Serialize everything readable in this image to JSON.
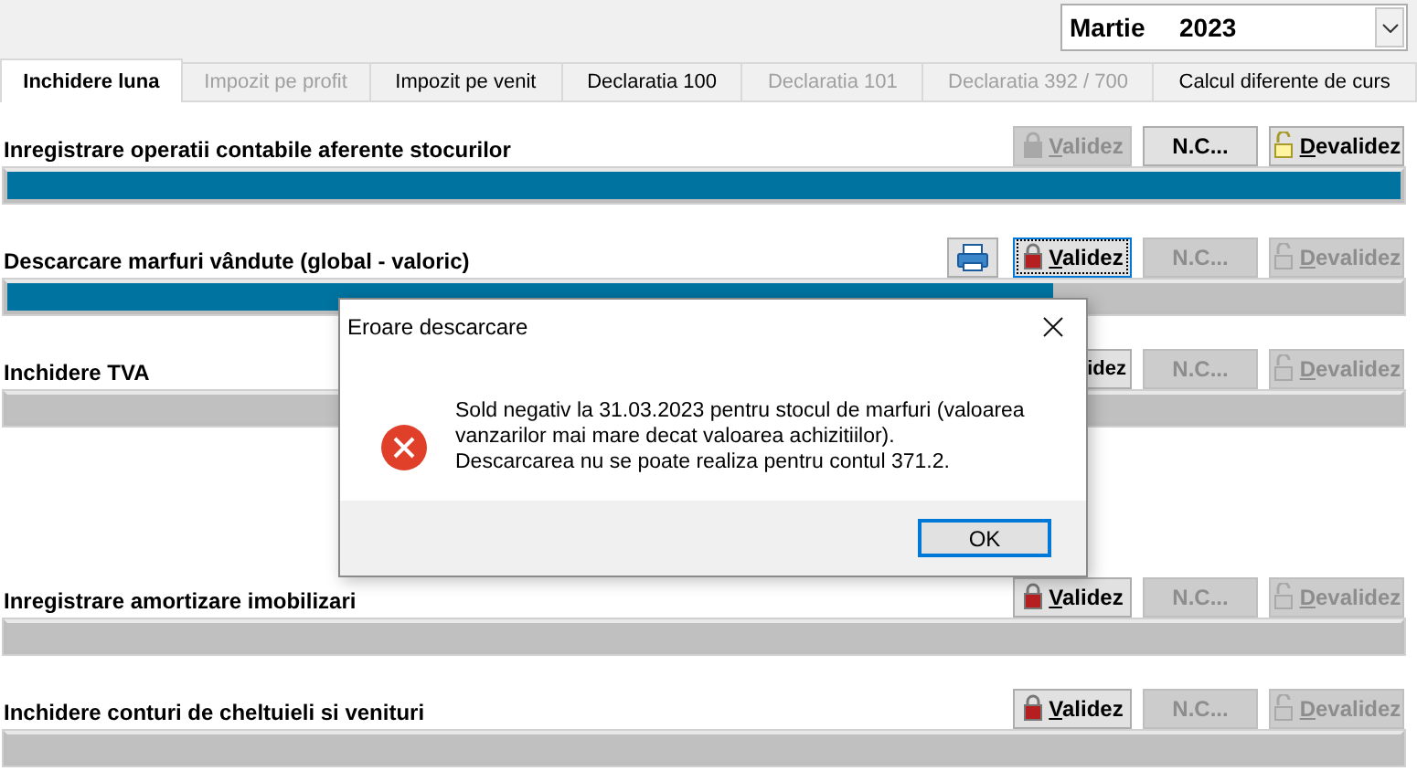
{
  "period": {
    "month": "Martie",
    "year": "2023"
  },
  "tabs": [
    {
      "label": "Inchidere luna",
      "selected": true,
      "disabled": false
    },
    {
      "label": "Impozit pe profit",
      "selected": false,
      "disabled": true
    },
    {
      "label": "Impozit pe venit",
      "selected": false,
      "disabled": false
    },
    {
      "label": "Declaratia 100",
      "selected": false,
      "disabled": false
    },
    {
      "label": "Declaratia 101",
      "selected": false,
      "disabled": true
    },
    {
      "label": "Declaratia 392 / 700",
      "selected": false,
      "disabled": true
    },
    {
      "label": "Calcul diferente de curs",
      "selected": false,
      "disabled": false
    }
  ],
  "sections": [
    {
      "title": "Inregistrare operatii contabile aferente stocurilor",
      "level": 1,
      "spaced": false,
      "print": false,
      "buttons": [
        {
          "kind": "validate",
          "label": "Validez",
          "disabled": true,
          "focused": false,
          "mnemonic": true,
          "locked": true
        },
        {
          "kind": "nc",
          "label": "N.C...",
          "disabled": false,
          "focused": false,
          "mnemonic": false
        },
        {
          "kind": "invalidate",
          "label": "Devalidez",
          "disabled": false,
          "focused": false,
          "mnemonic": true,
          "locked": false
        }
      ]
    },
    {
      "title": "Descarcare marfuri vândute (global - valoric)",
      "level": 0.75,
      "spaced": false,
      "print": true,
      "buttons": [
        {
          "kind": "validate",
          "label": "Validez",
          "disabled": false,
          "focused": true,
          "mnemonic": true,
          "locked": true
        },
        {
          "kind": "nc",
          "label": "N.C...",
          "disabled": true,
          "focused": false,
          "mnemonic": false
        },
        {
          "kind": "invalidate",
          "label": "Devalidez",
          "disabled": true,
          "focused": false,
          "mnemonic": true,
          "locked": false
        }
      ]
    },
    {
      "title": "Inchidere TVA",
      "level": 0,
      "spaced": false,
      "print": false,
      "buttons": [
        {
          "kind": "validate",
          "label": "idez",
          "disabled": false,
          "focused": false,
          "mnemonic": false,
          "clipped": true
        },
        {
          "kind": "nc",
          "label": "N.C...",
          "disabled": true,
          "focused": false,
          "mnemonic": false
        },
        {
          "kind": "invalidate",
          "label": "Devalidez",
          "disabled": true,
          "focused": false,
          "mnemonic": true,
          "locked": false
        }
      ]
    },
    {
      "title": "Inregistrare amortizare imobilizari",
      "level": 0,
      "spaced": true,
      "print": false,
      "buttons": [
        {
          "kind": "validate",
          "label": "Validez",
          "disabled": false,
          "focused": false,
          "mnemonic": true,
          "locked": true
        },
        {
          "kind": "nc",
          "label": "N.C...",
          "disabled": true,
          "focused": false,
          "mnemonic": false
        },
        {
          "kind": "invalidate",
          "label": "Devalidez",
          "disabled": true,
          "focused": false,
          "mnemonic": true,
          "locked": false
        }
      ]
    },
    {
      "title": "Inchidere conturi de cheltuieli si venituri",
      "level": 0,
      "spaced": false,
      "print": false,
      "buttons": [
        {
          "kind": "validate",
          "label": "Validez",
          "disabled": false,
          "focused": false,
          "mnemonic": true,
          "locked": true
        },
        {
          "kind": "nc",
          "label": "N.C...",
          "disabled": true,
          "focused": false,
          "mnemonic": false
        },
        {
          "kind": "invalidate",
          "label": "Devalidez",
          "disabled": true,
          "focused": false,
          "mnemonic": true,
          "locked": false
        }
      ]
    }
  ],
  "dialog": {
    "title": "Eroare descarcare",
    "message": "Sold negativ la 31.03.2023 pentru stocul de marfuri (valoarea\nvanzarilor mai mare decat valoarea achizitiilor).\nDescarcarea nu se poate realiza pentru contul 371.2.",
    "buttons": [
      {
        "label": "OK",
        "selected": true
      }
    ]
  }
}
